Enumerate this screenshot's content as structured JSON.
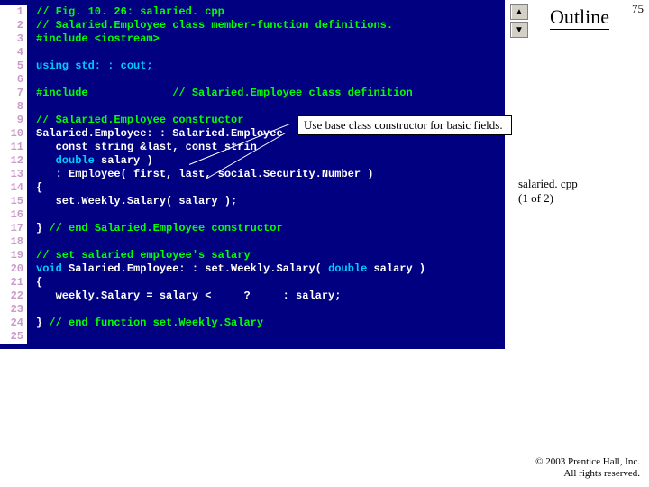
{
  "slide_number": "75",
  "outline_label": "Outline",
  "side_label_line1": "salaried. cpp",
  "side_label_line2": "(1 of 2)",
  "callout_text": "Use base class constructor for basic fields.",
  "copyright_line1": "© 2003 Prentice Hall, Inc.",
  "copyright_line2": "All rights reserved.",
  "nav_up": "▲",
  "nav_down": "▼",
  "code": {
    "l1": {
      "t": "// Fig. 10. 26: salaried. cpp",
      "c": "cm"
    },
    "l2": {
      "t": "// Salaried.Employee class member-function definitions.",
      "c": "cm"
    },
    "l3": {
      "t": "#include <iostream>",
      "c": "pp"
    },
    "l4": {
      "t": "",
      "c": "pl"
    },
    "l5": {
      "t": "using std: : cout;",
      "c": "kw"
    },
    "l6": {
      "t": "",
      "c": "pl"
    },
    "l7a": {
      "t": "#include",
      "c": "pp"
    },
    "l7b": {
      "t": "             // Salaried.Employee class definition",
      "c": "cm"
    },
    "l8": {
      "t": "",
      "c": "pl"
    },
    "l9": {
      "t": "// Salaried.Employee constructor",
      "c": "cm"
    },
    "l10": {
      "t": "Salaried.Employee: : Salaried.Employee",
      "c": "pl"
    },
    "l11": {
      "t": "   const string &last, const strin",
      "c": "pl"
    },
    "l12a": {
      "t": "   ",
      "c": "pl"
    },
    "l12b": {
      "t": "double",
      "c": "kw"
    },
    "l12c": {
      "t": " salary )",
      "c": "pl"
    },
    "l13": {
      "t": "   : Employee( first, last, social.Security.Number )",
      "c": "pl"
    },
    "l14": {
      "t": "{",
      "c": "pl"
    },
    "l15": {
      "t": "   set.Weekly.Salary( salary );",
      "c": "pl"
    },
    "l16": {
      "t": "",
      "c": "pl"
    },
    "l17a": {
      "t": "} ",
      "c": "pl"
    },
    "l17b": {
      "t": "// end Salaried.Employee constructor",
      "c": "cm"
    },
    "l18": {
      "t": "",
      "c": "pl"
    },
    "l19": {
      "t": "// set salaried employee's salary",
      "c": "cm"
    },
    "l20a": {
      "t": "void",
      "c": "kw"
    },
    "l20b": {
      "t": " Salaried.Employee: : set.Weekly.Salary( ",
      "c": "pl"
    },
    "l20c": {
      "t": "double",
      "c": "kw"
    },
    "l20d": {
      "t": " salary )",
      "c": "pl"
    },
    "l21": {
      "t": "{",
      "c": "pl"
    },
    "l22": {
      "t": "   weekly.Salary = salary <     ?     : salary;",
      "c": "pl"
    },
    "l23": {
      "t": "",
      "c": "pl"
    },
    "l24a": {
      "t": "} ",
      "c": "pl"
    },
    "l24b": {
      "t": "// end function set.Weekly.Salary",
      "c": "cm"
    },
    "l25": {
      "t": "",
      "c": "pl"
    }
  },
  "line_numbers": [
    "1",
    "2",
    "3",
    "4",
    "5",
    "6",
    "7",
    "8",
    "9",
    "10",
    "11",
    "12",
    "13",
    "14",
    "15",
    "16",
    "17",
    "18",
    "19",
    "20",
    "21",
    "22",
    "23",
    "24",
    "25"
  ]
}
